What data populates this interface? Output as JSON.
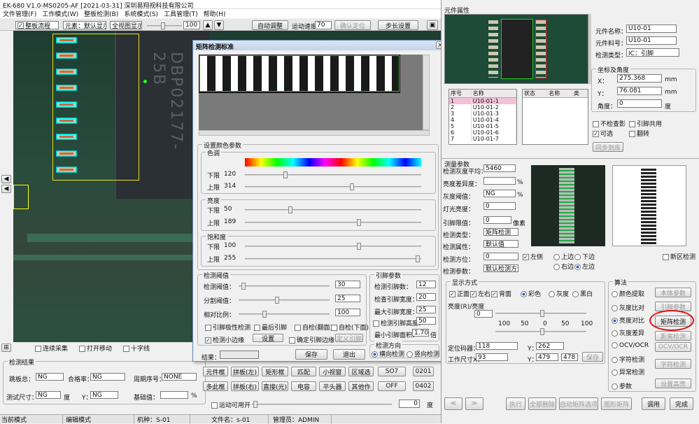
{
  "window": {
    "title": "EK-680 V1.0-MS0205-AF [2021-03-31] 深圳易翔视科技有限公司"
  },
  "menu": [
    "文件管理(F)",
    "工作模式(W)",
    "整板检测(B)",
    "系统模式(S)",
    "工具管理(T)",
    "帮助(H)"
  ],
  "toolbar": {
    "program_label": "整板流程",
    "view_select": "元素：默认显示",
    "mode_select": "全视图显示",
    "zoom_value": "100",
    "btn_auto": "自动调整",
    "speed_label": "运动速度：",
    "speed_value": "70",
    "btn_locate": "确认定位",
    "btn_step": "步长设置"
  },
  "bottom_checks": [
    {
      "label": "连续采集",
      "checked": false
    },
    {
      "label": "打开移动",
      "checked": false
    },
    {
      "label": "十字线",
      "checked": false
    }
  ],
  "results": {
    "title": "检测结果",
    "rows": [
      {
        "l1": "跳板总：",
        "v1": "NG",
        "l2": "合格率：",
        "v2": "NG",
        "l3": "周期序号：",
        "v3": "NONE"
      },
      {
        "l1": "测试尺寸：",
        "v1": "NG",
        "u1": "度",
        "l2": "Y：",
        "v2": "NG",
        "l3": "基础值：",
        "v3": "",
        "u3": "%"
      }
    ]
  },
  "mid_buttons": [
    [
      "元件框",
      "拼板(左)",
      "矩形框",
      "匹配",
      "小视窗",
      "区域选",
      "SO7",
      "0201"
    ],
    [
      "多此框",
      "拼板(右)",
      "直接(光)",
      "电容",
      "平头器",
      "其他作",
      "OFF",
      "0402"
    ]
  ],
  "mid_checkbox": "运动可用开",
  "mid_value": "0",
  "mid_unit": "度",
  "status": [
    {
      "label": "当前模式",
      "value": ""
    },
    {
      "label": "编辑模式",
      "value": ""
    },
    {
      "label": "机种：",
      "value": "S-01"
    },
    {
      "label": "文件名：",
      "value": "s-01"
    },
    {
      "label": "管理员：",
      "value": "ADMIN"
    }
  ],
  "dialog": {
    "title": "矩阵检测标准",
    "color_group": "设置颜色参数",
    "hue": "色调",
    "hue_lower": "下限",
    "hue_lower_v": "120",
    "hue_upper": "上限",
    "hue_upper_v": "314",
    "bright": "亮度",
    "bright_lower": "下限",
    "bright_lower_v": "50",
    "bright_upper": "上限",
    "bright_upper_v": "189",
    "sat": "饱和度",
    "sat_lower": "下限",
    "sat_lower_v": "100",
    "sat_upper": "上限",
    "sat_upper_v": "255",
    "detect_group": "检测阈值",
    "th1": "检测阈值：",
    "th1_v": "30",
    "th2": "分割阈值：",
    "th2_v": "25",
    "th3": "相对比例：",
    "th3_v": "100",
    "checks": [
      {
        "label": "引脚极性检测",
        "checked": false
      },
      {
        "label": "最后引脚",
        "checked": false
      },
      {
        "label": "自检(翻面)",
        "checked": false
      },
      {
        "label": "自检(下面)",
        "checked": false
      },
      {
        "label": "检测小边缘",
        "checked": true
      },
      {
        "label": "确定引脚边缘",
        "checked": false
      }
    ],
    "btn_set": "设置",
    "btn_define": "定义引脚",
    "param_group": "引脚参数",
    "p1": "检测引脚数：",
    "p1_v": "12",
    "p2": "检查引脚宽度：",
    "p2_v": "20",
    "p3": "最大引脚宽度：",
    "p3_v": "25",
    "p4": "检测引脚高度：",
    "p4_v": "50",
    "p5": "最小引脚面积：",
    "p5_v": "1.70",
    "p5_unit": "倍",
    "direction_group": "检测方向",
    "dir1": "横向检测",
    "dir2": "竖向检测",
    "result_label": "结果：",
    "btn_ok": "保存",
    "btn_cancel": "退出"
  },
  "right": {
    "title": "元件属性",
    "name_label": "元件名称：",
    "name_v": "U10-01",
    "part_label": "元件料号：",
    "part_v": "U10-01",
    "type_label": "检测类型：",
    "type_v": "IC：引脚",
    "pos_group": "坐标及角度",
    "x_label": "X：",
    "x_v": "275.368",
    "x_unit": "mm",
    "y_label": "Y：",
    "y_v": "76.081",
    "y_unit": "mm",
    "ang_label": "角度：",
    "ang_v": "0",
    "ang_unit": "度",
    "checks": [
      {
        "label": "不检查影",
        "checked": false
      },
      {
        "label": "引脚共用",
        "checked": false
      },
      {
        "label": "可选",
        "checked": true
      },
      {
        "label": "翻转",
        "checked": false
      }
    ],
    "btn_sync": "同步到库",
    "list1_headers": [
      "序号",
      "名称"
    ],
    "list1_rows": [
      "U10-01-1",
      "U10-01-2",
      "U10-01-3",
      "U10-01-4",
      "U10-01-5",
      "U10-01-6",
      "U10-01-7"
    ],
    "list2_headers": [
      "状态",
      "名称",
      "类"
    ],
    "param_title": "测量参数",
    "params": [
      {
        "l": "检测灰度平均：",
        "v": "5460",
        "u": ""
      },
      {
        "l": "亮度差异度：",
        "v": "",
        "u": "%"
      },
      {
        "l": "灰度阈值：",
        "v": "NG",
        "u": "%"
      },
      {
        "l": "灯光亮度：",
        "v": "0",
        "u": ""
      },
      {
        "l": "引脚限值：",
        "v": "0",
        "u": "像素"
      },
      {
        "l": "检测类型：",
        "v": "矩阵检测",
        "u": ""
      },
      {
        "l": "检测属性：",
        "v": "默认值",
        "u": ""
      },
      {
        "l": "检测方位：",
        "v": "0",
        "u": ""
      },
      {
        "l": "检测参数：",
        "v": "默认检测方法",
        "u": ""
      }
    ],
    "pos_radios": [
      "左侧",
      "上边",
      "下边",
      "右边",
      "左边"
    ],
    "new_check": "新区检测",
    "view_group": "显示方式",
    "view_opts": [
      "正面",
      "左右",
      "背面",
      "彩色",
      "灰度",
      "黑白"
    ],
    "area_label": "亮度(R)/亮度",
    "area_v": "0",
    "scale": [
      "0",
      "100",
      "50",
      "0",
      "50",
      "100"
    ],
    "extra": [
      {
        "l": "定位码器：",
        "v": "118"
      },
      {
        "l": "Y：",
        "v": "262"
      },
      {
        "l": "工作尺寸X：",
        "v": "93"
      },
      {
        "l": "Y：",
        "v": "479"
      },
      {
        "l": "",
        "v": "478"
      }
    ],
    "btn_save": "保存",
    "algo_group": "算法",
    "algos": [
      "颜色提取",
      "灰度比对",
      "亮度对比",
      "灰度差异",
      "OCV/OCR",
      "字符检测",
      "异常检测",
      "参数"
    ],
    "algo_btns": [
      "本体参数",
      "引脚参数",
      "矩阵检测",
      "距离检测",
      "OCV/OCR",
      "字符检测",
      "设置高亮"
    ],
    "bottom_btns": [
      "执行",
      "全部删除",
      "自动矩阵选项",
      "图形矩阵",
      "调用",
      "完成"
    ]
  }
}
